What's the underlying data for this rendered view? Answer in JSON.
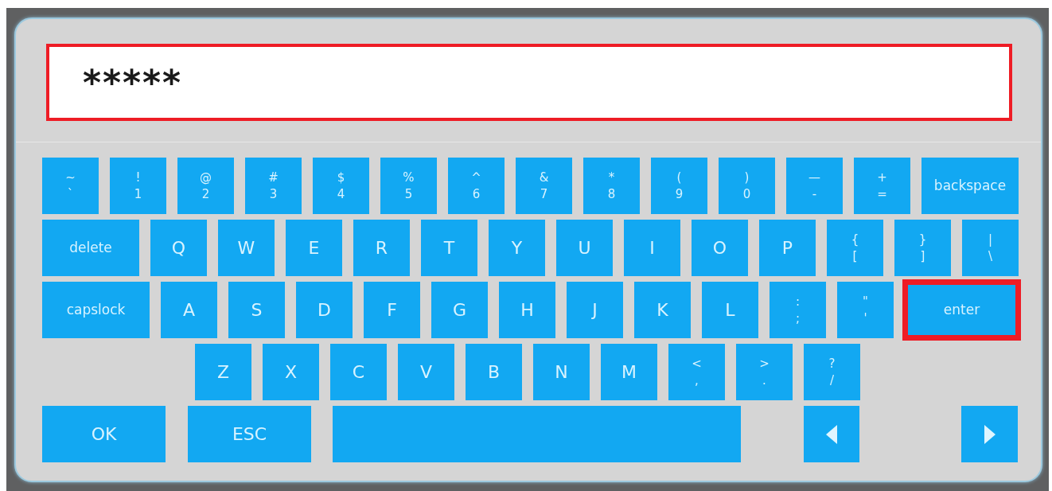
{
  "field": {
    "value": "*****",
    "highlighted": true
  },
  "rows": [
    {
      "keys": [
        {
          "kind": "dual",
          "upper": "~",
          "lower": "`",
          "highlighted": false
        },
        {
          "kind": "dual",
          "upper": "!",
          "lower": "1",
          "highlighted": false
        },
        {
          "kind": "dual",
          "upper": "@",
          "lower": "2",
          "highlighted": false
        },
        {
          "kind": "dual",
          "upper": "#",
          "lower": "3",
          "highlighted": false
        },
        {
          "kind": "dual",
          "upper": "$",
          "lower": "4",
          "highlighted": false
        },
        {
          "kind": "dual",
          "upper": "%",
          "lower": "5",
          "highlighted": false
        },
        {
          "kind": "dual",
          "upper": "^",
          "lower": "6",
          "highlighted": false
        },
        {
          "kind": "dual",
          "upper": "&",
          "lower": "7",
          "highlighted": false
        },
        {
          "kind": "dual",
          "upper": "*",
          "lower": "8",
          "highlighted": false
        },
        {
          "kind": "dual",
          "upper": "(",
          "lower": "9",
          "highlighted": false
        },
        {
          "kind": "dual",
          "upper": ")",
          "lower": "0",
          "highlighted": false
        },
        {
          "kind": "dual",
          "upper": "—",
          "lower": "-",
          "highlighted": false
        },
        {
          "kind": "dual",
          "upper": "+",
          "lower": "=",
          "highlighted": false
        },
        {
          "kind": "word",
          "label": "backspace",
          "highlighted": false
        }
      ]
    },
    {
      "keys": [
        {
          "kind": "word",
          "label": "delete",
          "highlighted": false
        },
        {
          "kind": "letter",
          "label": "Q",
          "highlighted": false
        },
        {
          "kind": "letter",
          "label": "W",
          "highlighted": false
        },
        {
          "kind": "letter",
          "label": "E",
          "highlighted": false
        },
        {
          "kind": "letter",
          "label": "R",
          "highlighted": false
        },
        {
          "kind": "letter",
          "label": "T",
          "highlighted": false
        },
        {
          "kind": "letter",
          "label": "Y",
          "highlighted": false
        },
        {
          "kind": "letter",
          "label": "U",
          "highlighted": false
        },
        {
          "kind": "letter",
          "label": "I",
          "highlighted": false
        },
        {
          "kind": "letter",
          "label": "O",
          "highlighted": false
        },
        {
          "kind": "letter",
          "label": "P",
          "highlighted": false
        },
        {
          "kind": "dual",
          "upper": "{",
          "lower": "[",
          "highlighted": false
        },
        {
          "kind": "dual",
          "upper": "}",
          "lower": "]",
          "highlighted": false
        },
        {
          "kind": "dual",
          "upper": "|",
          "lower": "\\",
          "highlighted": false
        }
      ]
    },
    {
      "keys": [
        {
          "kind": "word",
          "label": "capslock",
          "highlighted": false
        },
        {
          "kind": "letter",
          "label": "A",
          "highlighted": false
        },
        {
          "kind": "letter",
          "label": "S",
          "highlighted": false
        },
        {
          "kind": "letter",
          "label": "D",
          "highlighted": false
        },
        {
          "kind": "letter",
          "label": "F",
          "highlighted": false
        },
        {
          "kind": "letter",
          "label": "G",
          "highlighted": false
        },
        {
          "kind": "letter",
          "label": "H",
          "highlighted": false
        },
        {
          "kind": "letter",
          "label": "J",
          "highlighted": false
        },
        {
          "kind": "letter",
          "label": "K",
          "highlighted": false
        },
        {
          "kind": "letter",
          "label": "L",
          "highlighted": false
        },
        {
          "kind": "dual",
          "upper": ":",
          "lower": ";",
          "highlighted": false
        },
        {
          "kind": "dual",
          "upper": "\"",
          "lower": "'",
          "highlighted": false
        },
        {
          "kind": "word",
          "label": "enter",
          "highlighted": true
        }
      ]
    },
    {
      "keys": [
        {
          "kind": "letter",
          "label": "Z",
          "highlighted": false
        },
        {
          "kind": "letter",
          "label": "X",
          "highlighted": false
        },
        {
          "kind": "letter",
          "label": "C",
          "highlighted": false
        },
        {
          "kind": "letter",
          "label": "V",
          "highlighted": false
        },
        {
          "kind": "letter",
          "label": "B",
          "highlighted": false
        },
        {
          "kind": "letter",
          "label": "N",
          "highlighted": false
        },
        {
          "kind": "letter",
          "label": "M",
          "highlighted": false
        },
        {
          "kind": "dual",
          "upper": "<",
          "lower": ",",
          "highlighted": false
        },
        {
          "kind": "dual",
          "upper": ">",
          "lower": ".",
          "highlighted": false
        },
        {
          "kind": "dual",
          "upper": "?",
          "lower": "/",
          "highlighted": false
        }
      ]
    },
    {
      "keys": [
        {
          "kind": "big",
          "label": "OK",
          "highlighted": false
        },
        {
          "kind": "big",
          "label": "ESC",
          "highlighted": false
        },
        {
          "kind": "space",
          "highlighted": false
        },
        {
          "kind": "leftarrow",
          "highlighted": false
        },
        {
          "kind": "rightarrow",
          "highlighted": false
        }
      ]
    }
  ]
}
